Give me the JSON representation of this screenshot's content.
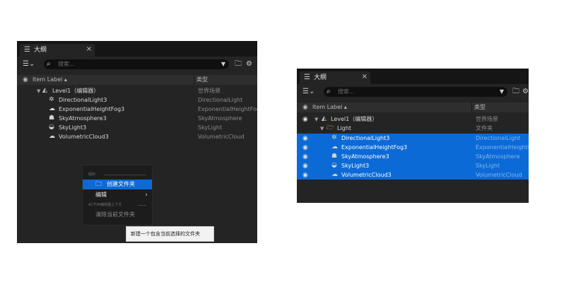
{
  "left_panel": {
    "tab": {
      "title": "大纲",
      "close": "×"
    },
    "search": {
      "placeholder": "搜索..."
    },
    "header": {
      "label_col": "Item Label ▴",
      "type_col": "类型"
    },
    "rows": [
      {
        "label": "Level1（编辑器）",
        "type": "世界场景",
        "icon": "level-icon"
      },
      {
        "label": "DirectionalLight3",
        "type": "DirectionalLight",
        "icon": "directional-light-icon"
      },
      {
        "label": "ExponentialHeightFog3",
        "type": "ExponentialHeightFog",
        "icon": "fog-icon"
      },
      {
        "label": "SkyAtmosphere3",
        "type": "SkyAtmosphere",
        "icon": "sky-atmosphere-icon"
      },
      {
        "label": "SkyLight3",
        "type": "SkyLight",
        "icon": "sky-light-icon"
      },
      {
        "label": "VolumetricCloud3",
        "type": "VolumetricCloud",
        "icon": "cloud-icon"
      }
    ]
  },
  "context_menu": {
    "section1": "组织",
    "create_folder": "创建文件夹",
    "edit": "编辑",
    "section2": "ACTOR编辑器上下文",
    "clear_folder": "清除当前文件夹"
  },
  "tooltip": {
    "text": "新建一个包含当前选择的文件夹"
  },
  "right_panel": {
    "tab": {
      "title": "大纲",
      "close": "×"
    },
    "search": {
      "placeholder": "搜索..."
    },
    "header": {
      "label_col": "Item Label ▴",
      "type_col": "类型"
    },
    "rows": [
      {
        "label": "Level1（编辑器）",
        "type": "世界场景",
        "icon": "level-icon",
        "selected": false
      },
      {
        "label": "Light",
        "type": "文件夹",
        "icon": "folder-icon",
        "selected": false
      },
      {
        "label": "DirectionalLight3",
        "type": "DirectionalLight",
        "icon": "directional-light-icon",
        "selected": true
      },
      {
        "label": "ExponentialHeightFog3",
        "type": "ExponentialHeightFog",
        "icon": "fog-icon",
        "selected": true
      },
      {
        "label": "SkyAtmosphere3",
        "type": "SkyAtmosphere",
        "icon": "sky-atmosphere-icon",
        "selected": true
      },
      {
        "label": "SkyLight3",
        "type": "SkyLight",
        "icon": "sky-light-icon",
        "selected": true
      },
      {
        "label": "VolumetricCloud3",
        "type": "VolumetricCloud",
        "icon": "cloud-icon",
        "selected": true
      }
    ]
  },
  "colors": {
    "selection": "#0c6ad6",
    "panel_bg": "#242424",
    "tab_bg": "#151515"
  }
}
